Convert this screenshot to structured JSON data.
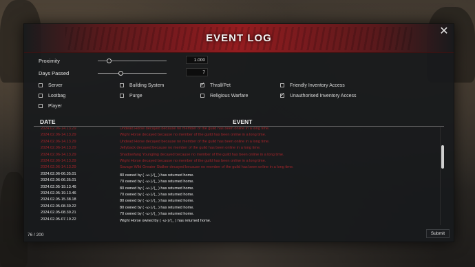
{
  "window": {
    "title": "EVENT LOG",
    "close_icon": "close-icon"
  },
  "sliders": [
    {
      "label": "Proximity",
      "value": "1.000",
      "fraction": 0.16
    },
    {
      "label": "Days Passed",
      "value": "7",
      "fraction": 0.33
    }
  ],
  "filters": [
    {
      "label": "Server",
      "checked": false
    },
    {
      "label": "Building System",
      "checked": false
    },
    {
      "label": "Thrall/Pet",
      "checked": true
    },
    {
      "label": "Friendly Inventory Access",
      "checked": false
    },
    {
      "label": "Lootbag",
      "checked": false
    },
    {
      "label": "Purge",
      "checked": false
    },
    {
      "label": "Religious Warfare",
      "checked": false
    },
    {
      "label": "Unauthorised Inventory Access",
      "checked": true
    },
    {
      "label": "Player",
      "checked": false
    }
  ],
  "table": {
    "columns": {
      "date": "DATE",
      "event": "EVENT"
    },
    "rows": [
      {
        "date": "2024.02.06-14.13.29",
        "event": "Undead Horse decayed because no member of the guild has been online in a long time.",
        "style": "red"
      },
      {
        "date": "2024.02.06-14.13.29",
        "event": "Wight Horse decayed because no member of the guild has been online in a long time.",
        "style": "red"
      },
      {
        "date": "2024.02.06-14.13.29",
        "event": "Undead Horse decayed because no member of the guild has been online in a long time.",
        "style": "red"
      },
      {
        "date": "2024.02.06-14.13.29",
        "event": "Jellyback decayed because no member of the guild has been online in a long time.",
        "style": "red"
      },
      {
        "date": "2024.02.06-14.13.29",
        "event": "Shadowfang Youngling decayed because no member of the guild has been online in a long time.",
        "style": "red"
      },
      {
        "date": "2024.02.06-14.13.29",
        "event": "Wight Horse decayed because no member of the guild has been online in a long time.",
        "style": "red"
      },
      {
        "date": "2024.02.06-14.13.29",
        "event": "Savage Wild Greater Stalker decayed because no member of the guild has been online in a long time.",
        "style": "red"
      },
      {
        "date": "2024.02.06-06.35.01",
        "event": "80 owned by ( ·ω·)ﾉ(_ ) has returned home.",
        "style": "white"
      },
      {
        "date": "2024.02.06-06.35.01",
        "event": "70 owned by ( ·ω·)ﾉ(_ ) has returned home.",
        "style": "white"
      },
      {
        "date": "2024.02.05-19.13.46",
        "event": "80 owned by ( ·ω·)ﾉ(_ ) has returned home.",
        "style": "white"
      },
      {
        "date": "2024.02.05-19.13.46",
        "event": "70 owned by ( ·ω·)ﾉ(_ ) has returned home.",
        "style": "white"
      },
      {
        "date": "2024.02.05-15.38.18",
        "event": "80 owned by ( ·ω·)ﾉ(_ ) has returned home.",
        "style": "white"
      },
      {
        "date": "2024.02.05-08.39.22",
        "event": "80 owned by ( ·ω·)ﾉ(_ ) has returned home.",
        "style": "white"
      },
      {
        "date": "2024.02.05-08.39.21",
        "event": "70 owned by ( ·ω·)ﾉ(_ ) has returned home.",
        "style": "white"
      },
      {
        "date": "2024.02.05-07.19.22",
        "event": "Wight Horse owned by ( ·ω·)ﾉ(_ ) has returned home.",
        "style": "white"
      }
    ]
  },
  "footer": {
    "count": "76 / 200",
    "submit_label": "Submit"
  }
}
